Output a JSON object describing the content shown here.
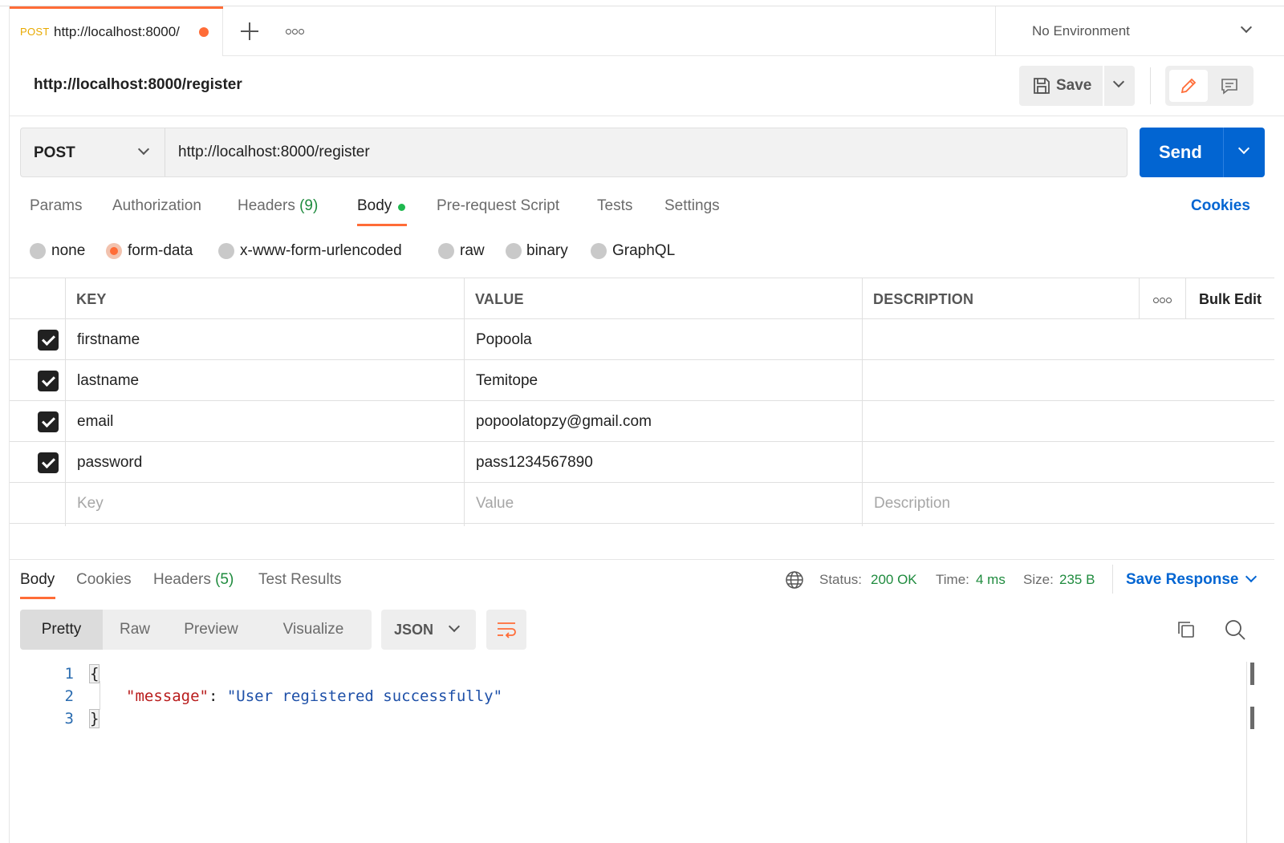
{
  "tab": {
    "method": "POST",
    "url": "http://localhost:8000/",
    "unsaved": true
  },
  "environment": {
    "label": "No Environment"
  },
  "request": {
    "title": "http://localhost:8000/register",
    "save_label": "Save",
    "method": "POST",
    "url": "http://localhost:8000/register",
    "send_label": "Send"
  },
  "request_tabs": {
    "params": "Params",
    "authorization": "Authorization",
    "headers": "Headers",
    "headers_count": "(9)",
    "body": "Body",
    "prerequest": "Pre-request Script",
    "tests": "Tests",
    "settings": "Settings",
    "cookies": "Cookies",
    "active": "body"
  },
  "body_types": {
    "none": "none",
    "form_data": "form-data",
    "urlencoded": "x-www-form-urlencoded",
    "raw": "raw",
    "binary": "binary",
    "graphql": "GraphQL",
    "selected": "form-data"
  },
  "table": {
    "headers": {
      "key": "KEY",
      "value": "VALUE",
      "description": "DESCRIPTION",
      "bulk_edit": "Bulk Edit"
    },
    "rows": [
      {
        "checked": true,
        "key": "firstname",
        "value": "Popoola",
        "description": ""
      },
      {
        "checked": true,
        "key": "lastname",
        "value": "Temitope",
        "description": ""
      },
      {
        "checked": true,
        "key": "email",
        "value": "popoolatopzy@gmail.com",
        "description": ""
      },
      {
        "checked": true,
        "key": "password",
        "value": "pass1234567890",
        "description": ""
      }
    ],
    "placeholders": {
      "key": "Key",
      "value": "Value",
      "description": "Description"
    }
  },
  "response": {
    "tabs": {
      "body": "Body",
      "cookies": "Cookies",
      "headers": "Headers",
      "headers_count": "(5)",
      "test_results": "Test Results"
    },
    "status_label": "Status:",
    "status": "200 OK",
    "time_label": "Time:",
    "time": "4 ms",
    "size_label": "Size:",
    "size": "235 B",
    "save_response": "Save Response",
    "views": {
      "pretty": "Pretty",
      "raw": "Raw",
      "preview": "Preview",
      "visualize": "Visualize",
      "active": "Pretty"
    },
    "format": "JSON",
    "code": {
      "line_numbers": [
        "1",
        "2",
        "3"
      ],
      "open_brace": "{",
      "key": "\"message\"",
      "colon": ": ",
      "value": "\"User registered successfully\"",
      "close_brace": "}"
    }
  },
  "colors": {
    "accent": "#ff6c37",
    "primary": "#0265d2",
    "success": "#1f8b3e",
    "method_post": "#e8a900"
  },
  "icons": {
    "new_tab": "plus-icon",
    "more": "more-horizontal-icon",
    "env_dropdown": "chevron-down-icon",
    "save": "floppy-disk-icon",
    "edit": "pencil-icon",
    "comments": "comment-icon",
    "globe": "globe-icon",
    "wrap": "word-wrap-icon",
    "copy": "copy-icon",
    "search": "search-icon"
  }
}
